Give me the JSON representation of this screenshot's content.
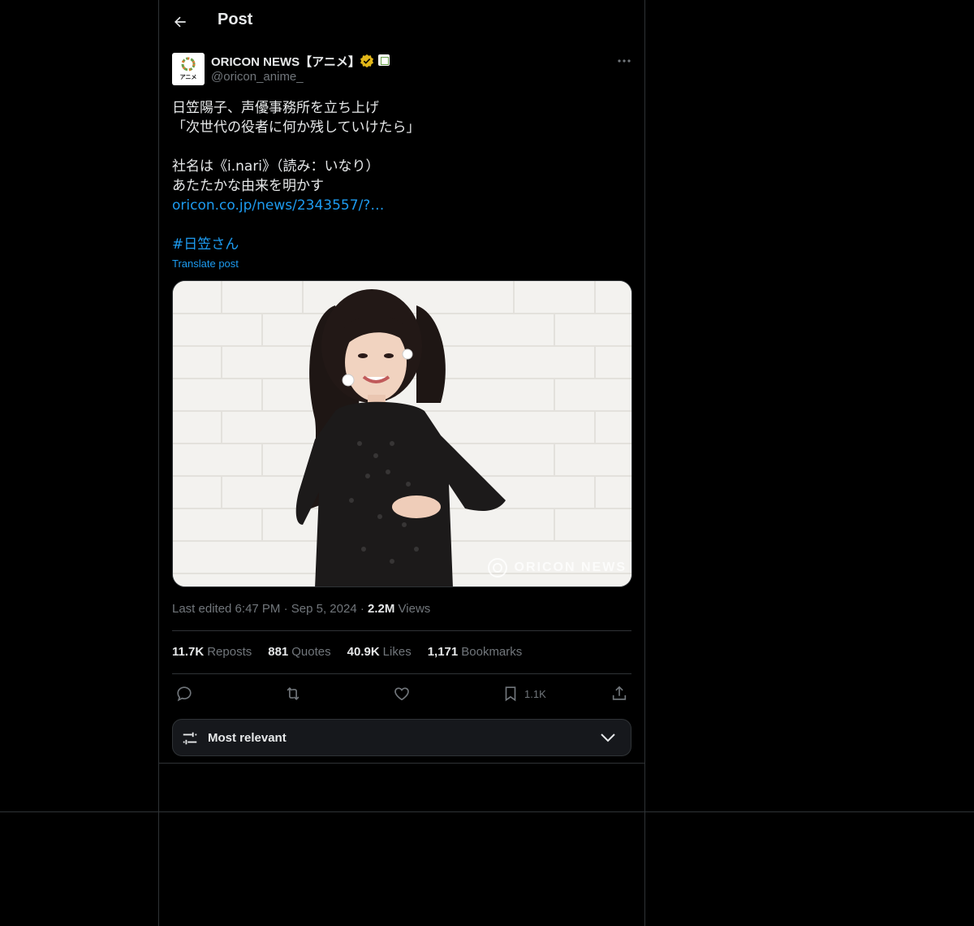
{
  "header": {
    "title": "Post"
  },
  "author": {
    "display_name": "ORICON NEWS【アニメ】",
    "handle": "@oricon_anime_",
    "avatar_text": "アニメ",
    "verified": true
  },
  "post": {
    "lines": [
      "日笠陽子、声優事務所を立ち上げ",
      "「次世代の役者に何か残していけたら」",
      "",
      "社名は《i.nari》（読み：いなり）",
      "あたたかな由来を明かす"
    ],
    "link": "oricon.co.jp/news/2343557/?…",
    "hashtag": "#日笠さん",
    "translate": "Translate post"
  },
  "media": {
    "watermark": "ORICON NEWS"
  },
  "meta": {
    "edited": "Last edited 6:47 PM",
    "date": "Sep 5, 2024",
    "views_count": "2.2M",
    "views_label": "Views"
  },
  "stats": {
    "reposts_count": "11.7K",
    "reposts_label": "Reposts",
    "quotes_count": "881",
    "quotes_label": "Quotes",
    "likes_count": "40.9K",
    "likes_label": "Likes",
    "bookmarks_count": "1,171",
    "bookmarks_label": "Bookmarks"
  },
  "actions": {
    "bookmark_count": "1.1K"
  },
  "sort": {
    "label": "Most relevant"
  },
  "icons": {
    "back": "arrow-left-icon",
    "more": "more-horizontal-icon",
    "reply": "reply-icon",
    "repost": "repost-icon",
    "like": "heart-icon",
    "bookmark": "bookmark-icon",
    "share": "share-icon",
    "sort": "sliders-icon",
    "chevron": "chevron-down-icon"
  },
  "colors": {
    "accent": "#1d9bf0",
    "background": "#000000",
    "muted": "#71767b",
    "verified": "#e2b719"
  }
}
